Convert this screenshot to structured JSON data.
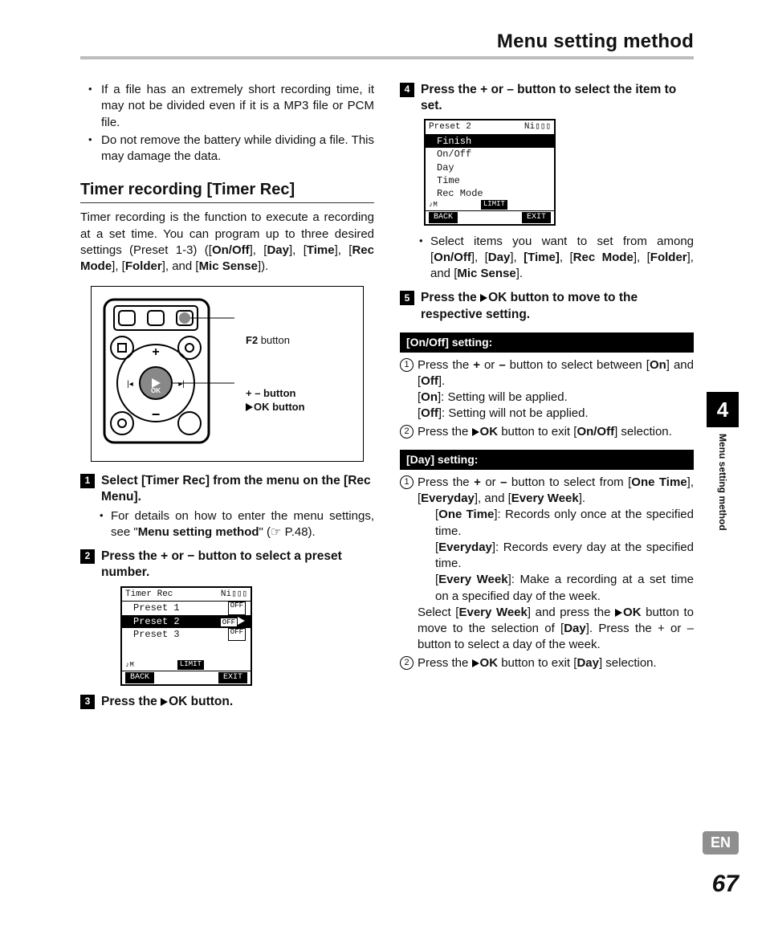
{
  "header": {
    "chapter_title": "Menu setting method"
  },
  "intro_bullets": [
    "If a file has an extremely short recording time, it may not be divided even if it is a MP3 file or PCM file.",
    "Do not remove the battery while dividing a file. This may damage the data."
  ],
  "section": {
    "title": "Timer recording [Timer Rec]",
    "desc_pre": "Timer recording is the function to execute a recording at a set time. You can program up to three desired settings (Preset 1-3) ([",
    "desc_params": [
      "On/Off",
      "Day",
      "Time",
      "Rec Mode",
      "Folder",
      "Mic Sense"
    ],
    "desc_post": "])."
  },
  "device_callouts": {
    "f2": "F2",
    "f2_suffix": " button",
    "pm": "+ – button",
    "ok_pre": "",
    "ok": "OK button"
  },
  "steps": {
    "s1_pre": "Select [",
    "s1_b1": "Timer Rec",
    "s1_mid": "] from the menu on the [",
    "s1_b2": "Rec Menu",
    "s1_post": "].",
    "s1_sub_pre": "For details on how to enter the menu settings, see \"",
    "s1_sub_b": "Menu setting method",
    "s1_sub_post": "\" (☞ P.48).",
    "s2": "Press the + or − button to select a preset number.",
    "s3": "Press the ",
    "s3_ok": "OK",
    "s3_post": " button.",
    "s4": "Press the + or – button to select the item to set.",
    "s4_sub_pre": "Select items you want to set from among [",
    "s4_sub_params": [
      "On/Off",
      "Day",
      "Time",
      "Rec Mode",
      "Folder",
      "Mic Sense"
    ],
    "s4_sub_post": "].",
    "s5_pre": "Press the ",
    "s5_ok": "OK",
    "s5_post": " button to move to the respective setting."
  },
  "lcd1": {
    "title": "Timer Rec",
    "rows": [
      {
        "label": "Preset 1",
        "val": "OFF",
        "sel": false
      },
      {
        "label": "Preset 2",
        "val": "OFF",
        "sel": true,
        "arrow": true
      },
      {
        "label": "Preset 3",
        "val": "OFF",
        "sel": false
      }
    ],
    "left_soft": "BACK",
    "right_soft": "EXIT",
    "status_left": "♪M",
    "status_mid": "LIMIT"
  },
  "lcd2": {
    "title": "Preset 2",
    "rows": [
      {
        "label": "Finish",
        "sel": true
      },
      {
        "label": "On/Off",
        "sel": false
      },
      {
        "label": "Day",
        "sel": false
      },
      {
        "label": "Time",
        "sel": false
      },
      {
        "label": "Rec Mode",
        "sel": false
      }
    ],
    "left_soft": "BACK",
    "right_soft": "EXIT",
    "status_left": "♪M",
    "status_mid": "LIMIT"
  },
  "onoff": {
    "header": "[On/Off] setting:",
    "l1_pre": "Press the ",
    "l1_b1": "+",
    "l1_mid": " or ",
    "l1_b2": "–",
    "l1_post": " button to select between [",
    "l1_on": "On",
    "l1_and": "] and [",
    "l1_off": "Off",
    "l1_end": "].",
    "on_line_pre": "[",
    "on_line_b": "On",
    "on_line_post": "]: Setting will be applied.",
    "off_line_pre": "[",
    "off_line_b": "Off",
    "off_line_post": "]: Setting will not be applied.",
    "l2_pre": "Press the ",
    "l2_ok": "OK",
    "l2_mid": " button to exit [",
    "l2_b": "On/Off",
    "l2_post": "] selection."
  },
  "day": {
    "header": "[Day] setting:",
    "l1_pre": "Press the ",
    "l1_b1": "+",
    "l1_mid": " or ",
    "l1_b2": "–",
    "l1_post": " button to select from [",
    "o1": "One Time",
    "sep1": "], [",
    "o2": "Everyday",
    "sep2": "], and [",
    "o3": "Every Week",
    "end": "].",
    "d1_pre": "[",
    "d1_b": "One Time",
    "d1_post": "]: Records only once at the specified time.",
    "d2_pre": "[",
    "d2_b": "Everyday",
    "d2_post": "]: Records every day at the specified time.",
    "d3_pre": "[",
    "d3_b": "Every Week",
    "d3_post": "]: Make a recording at a set time on a specified day of the week.",
    "sel_pre": "Select [",
    "sel_b": "Every Week",
    "sel_mid": "] and press the ",
    "sel_ok": "OK",
    "sel_mid2": " button to move to the selection of [",
    "sel_b2": "Day",
    "sel_post": "]. Press the + or – button to select a day of the week.",
    "l2_pre": "Press the ",
    "l2_ok": "OK",
    "l2_mid": " button to exit [",
    "l2_b": "Day",
    "l2_post": "] selection."
  },
  "side": {
    "num": "4",
    "label": "Menu setting method"
  },
  "footer": {
    "lang": "EN",
    "page": "67"
  },
  "battery_icon": "Ni"
}
